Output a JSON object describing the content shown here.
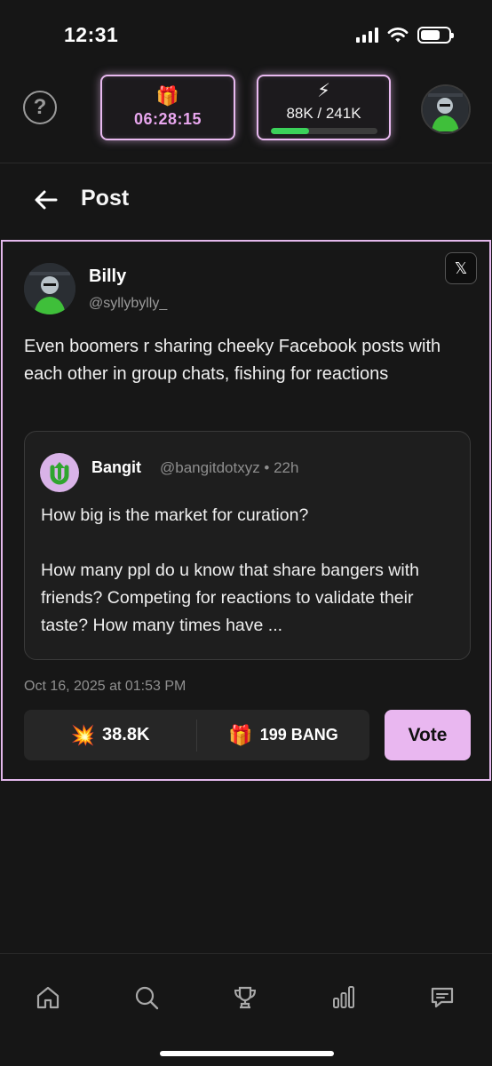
{
  "status_bar": {
    "time": "12:31"
  },
  "header": {
    "timer_icon": "gift-icon",
    "timer": "06:28:15",
    "energy_icon": "lightning-icon",
    "energy": "88K / 241K",
    "energy_progress": 0.365
  },
  "page": {
    "title": "Post"
  },
  "post": {
    "author_name": "Billy",
    "author_handle": "@syllybylly_",
    "text": "Even boomers r sharing cheeky Facebook posts with each other in group chats, fishing for reactions",
    "quote": {
      "name": "Bangit",
      "meta": "@bangitdotxyz • 22h",
      "line1": "How big is the market for curation?",
      "line2": "How many ppl do u know that share bangers with friends? Competing for reactions to validate their taste? How many times have ..."
    },
    "date": "Oct 16, 2025 at 01:53 PM",
    "stats": {
      "reactions": "38.8K",
      "reward": "199 BANG"
    },
    "vote_label": "Vote"
  },
  "colors": {
    "accent": "#e9b7f0",
    "background": "#161616",
    "energy_green": "#3bd15a"
  },
  "nav": [
    "home-icon",
    "search-icon",
    "trophy-icon",
    "bar-chart-icon",
    "chat-icon"
  ]
}
